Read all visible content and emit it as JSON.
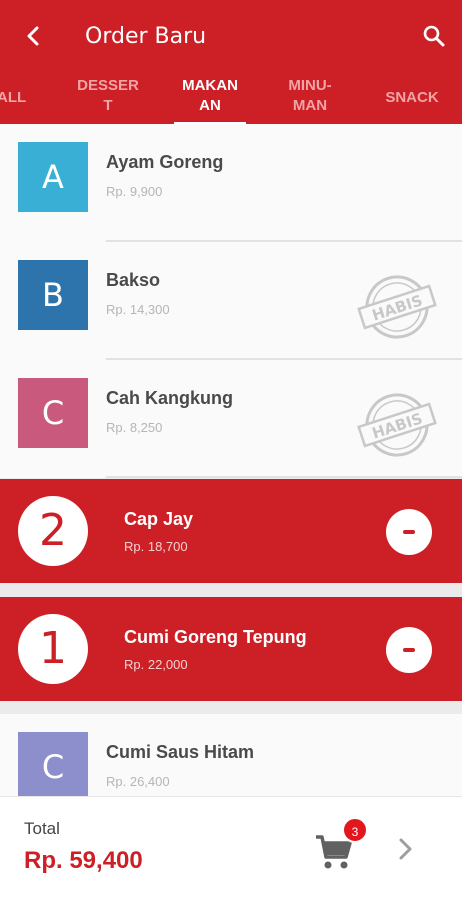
{
  "header": {
    "title": "Order Baru",
    "back_icon": "arrow-left-icon",
    "search_icon": "search-icon"
  },
  "tabs": [
    {
      "label": "ALL",
      "active": false
    },
    {
      "label": "DESSER\nT",
      "active": false
    },
    {
      "label": "MAKAN\nAN",
      "active": true
    },
    {
      "label": "MINU-\nMAN",
      "active": false
    },
    {
      "label": "SNACK",
      "active": false
    }
  ],
  "items": [
    {
      "initial": "A",
      "name": "Ayam Goreng",
      "price": "Rp. 9,900",
      "color": "#3aafd6",
      "sold_out": false
    },
    {
      "initial": "B",
      "name": "Bakso",
      "price": "Rp. 14,300",
      "color": "#2d74ad",
      "sold_out": true
    },
    {
      "initial": "C",
      "name": "Cah Kangkung",
      "price": "Rp. 8,250",
      "color": "#c95a7e",
      "sold_out": true
    },
    {
      "quantity": "2",
      "name": "Cap Jay",
      "price": "Rp. 18,700",
      "selected": true
    },
    {
      "quantity": "1",
      "name": "Cumi Goreng Tepung",
      "price": "Rp. 22,000",
      "selected": true
    },
    {
      "initial": "C",
      "name": "Cumi Saus Hitam",
      "price": "Rp. 26,400",
      "color": "#8d8fcc",
      "sold_out": false
    }
  ],
  "sold_out_stamp": "HABIS",
  "footer": {
    "total_label": "Total",
    "total_value": "Rp. 59,400",
    "cart_count": "3",
    "cart_icon": "shopping-cart-icon",
    "next_icon": "chevron-right-icon"
  },
  "colors": {
    "primary": "#cd2026",
    "tab_inactive": "#f1a4a6",
    "badge": "#e2161c"
  }
}
